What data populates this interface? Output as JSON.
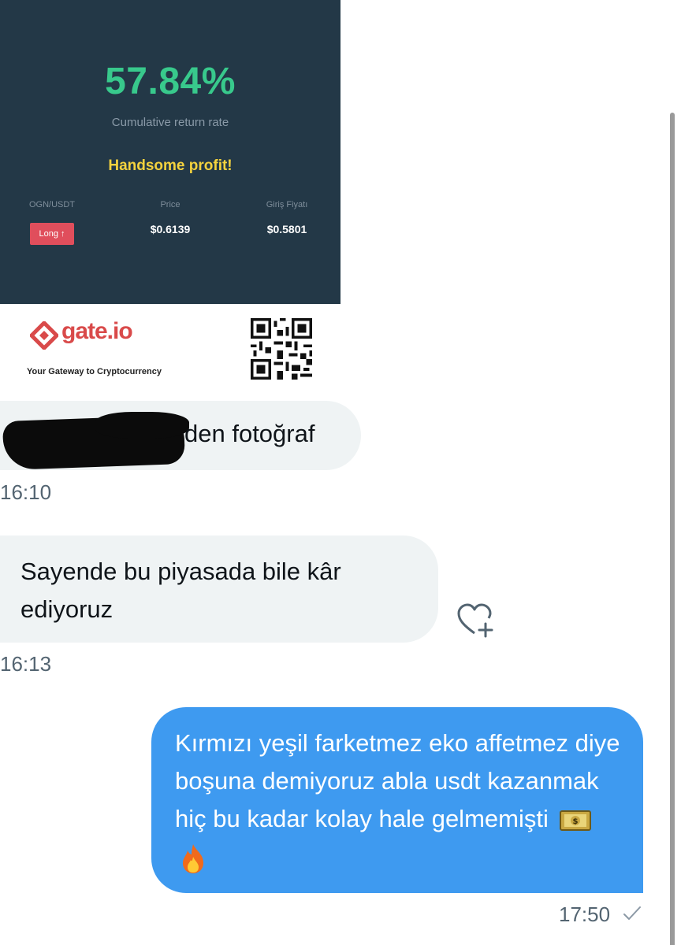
{
  "card": {
    "percent": "57.84%",
    "percent_label": "Cumulative return rate",
    "profit_label": "Handsome profit!",
    "pair_header": "OGN/USDT",
    "price_header": "Price",
    "entry_header": "Giriş Fiyatı",
    "position_label": "Long ↑",
    "price_value": "$0.6139",
    "entry_value": "$0.5801",
    "brand_name": "gate.io",
    "tagline": "Your Gateway to Cryptocurrency"
  },
  "messages": [
    {
      "text": "den fotoğraf",
      "time": "16:10",
      "direction": "incoming"
    },
    {
      "text": "Sayende bu piyasada bile kâr ediyoruz",
      "time": "16:13",
      "direction": "incoming"
    },
    {
      "text": "Kırmızı yeşil farketmez eko affetmez diye boşuna demiyoruz abla usdt kazanmak hiç bu kadar kolay hale gelmemişti",
      "time": "17:50",
      "direction": "outgoing"
    }
  ],
  "icons": [
    "heart-plus-icon",
    "check-icon",
    "money-emoji-icon",
    "fire-emoji-icon",
    "qr-code-icon",
    "gate-logo-icon"
  ],
  "colors": {
    "outgoing_bubble": "#3e9af0",
    "incoming_bubble": "#eff3f4",
    "card_bg": "#233847",
    "accent_green": "#38c98c",
    "profit_yellow": "#f4d23e"
  }
}
